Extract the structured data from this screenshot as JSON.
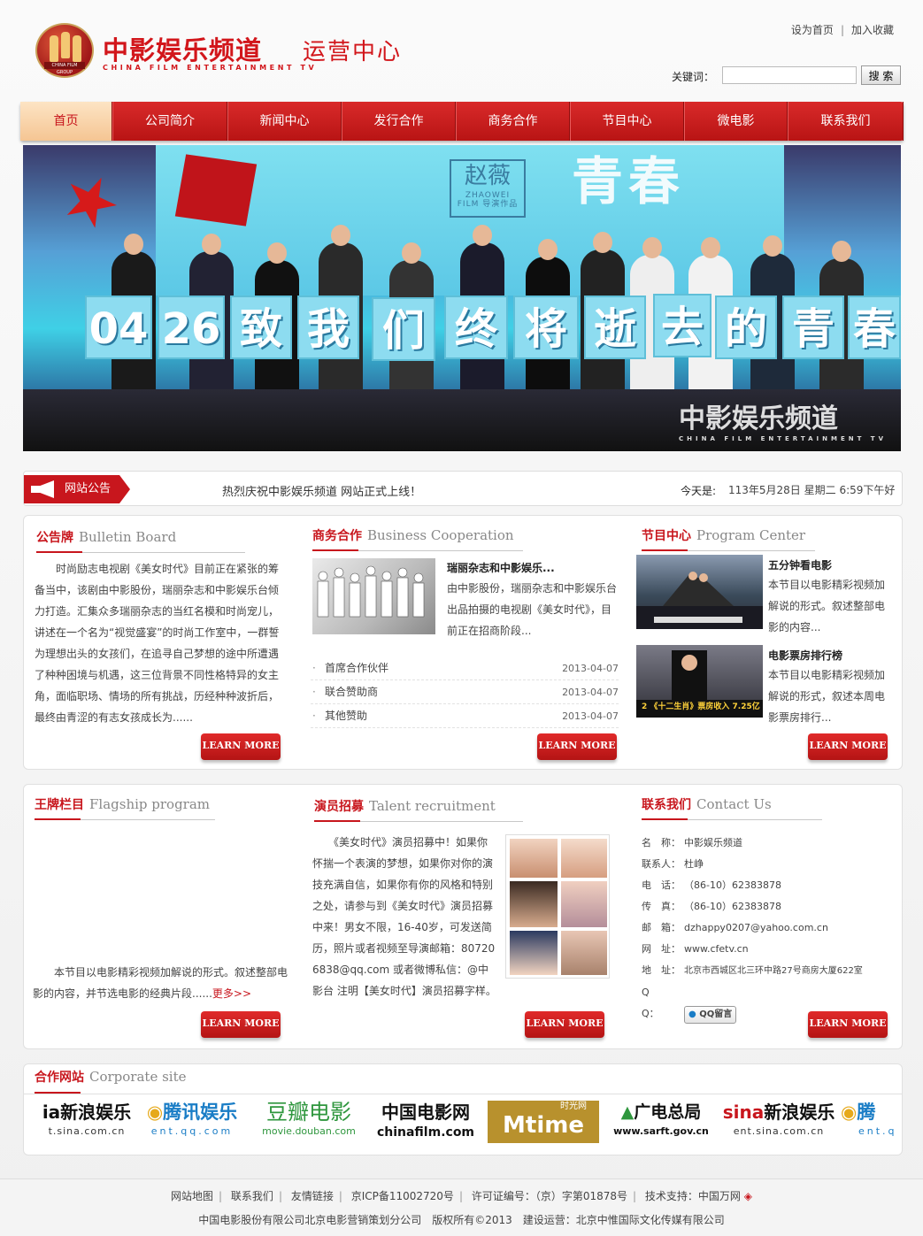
{
  "header": {
    "logo_cn": "中影娱乐频道",
    "logo_sub": "运营中心",
    "logo_en": "CHINA FILM ENTERTAINMENT TV",
    "logo_emblem_text": "CHINA FILM GROUP",
    "set_home": "设为首页",
    "add_fav": "加入收藏",
    "link_sep": "|",
    "search_label": "关键词：",
    "search_value": "",
    "search_button": "搜 索"
  },
  "nav": [
    "首页",
    "公司简介",
    "新闻中心",
    "发行合作",
    "商务合作",
    "节目中心",
    "微电影",
    "联系我们"
  ],
  "banner": {
    "card_text": [
      "04",
      "26",
      "致",
      "我",
      "们",
      "终",
      "将",
      "逝",
      "去",
      "的",
      "青",
      "春"
    ],
    "header_text": "青春",
    "director_cn": "赵薇",
    "director_en": "ZHAOWEI",
    "director_sub": "FILM 导演作品",
    "watermark_cn": "中影娱乐频道",
    "watermark_en": "CHINA FILM ENTERTAINMENT TV"
  },
  "notice": {
    "tag": "网站公告",
    "message": "热烈庆祝中影娱乐频道 网站正式上线！",
    "date_label": "今天是:",
    "date": "113年5月28日 星期二 6:59下午好"
  },
  "bulletin": {
    "title_cn": "公告牌",
    "title_en": "Bulletin Board",
    "text": "　　时尚励志电视剧《美女时代》目前正在紧张的筹备当中，该剧由中影股份，瑞丽杂志和中影娱乐台倾力打造。汇集众多瑞丽杂志的当红名模和时尚宠儿，讲述在一个名为“视觉盛宴”的时尚工作室中，一群誓为理想出头的女孩们，在追寻自己梦想的途中所遭遇了种种困境与机遇，这三位背景不同性格特异的女主角，面临职场、情场的所有挑战，历经种种波折后，最终由青涩的有志女孩成长为......",
    "more": "LEARN MORE"
  },
  "business": {
    "title_cn": "商务合作",
    "title_en": "Business Cooperation",
    "item_title": "瑞丽杂志和中影娱乐...",
    "item_desc": "由中影股份，瑞丽杂志和中影娱乐台出品拍摄的电视剧《美女时代》，目前正在招商阶段...",
    "list": [
      {
        "bullet": "·",
        "title": "首席合作伙伴",
        "date": "2013-04-07"
      },
      {
        "bullet": "·",
        "title": "联合赞助商",
        "date": "2013-04-07"
      },
      {
        "bullet": "·",
        "title": "其他赞助",
        "date": "2013-04-07"
      }
    ],
    "more": "LEARN MORE"
  },
  "program": {
    "title_cn": "节目中心",
    "title_en": "Program Center",
    "items": [
      {
        "title": "五分钟看电影",
        "desc": "本节目以电影精彩视频加解说的形式。叙述整部电影的内容..."
      },
      {
        "title": "电影票房排行榜",
        "desc": "本节目以电影精彩视频加解说的形式，叙述本周电影票房排行..."
      }
    ],
    "thumb2_caption": "2 《十二生肖》票房收入 7.25亿",
    "more": "LEARN MORE"
  },
  "flagship": {
    "title_cn": "王牌栏目",
    "title_en": "Flagship program",
    "text": "　　本节目以电影精彩视频加解说的形式。叙述整部电影的内容，并节选电影的经典片段......",
    "more_link": "更多>>",
    "more": "LEARN MORE"
  },
  "talent": {
    "title_cn": "演员招募",
    "title_en": "Talent recruitment",
    "text": "　　《美女时代》演员招募中！如果你怀揣一个表演的梦想，如果你对你的演技充满自信，如果你有你的风格和特别之处，请参与到《美女时代》演员招募中来！男女不限，16-40岁，可发送简历，照片或者视频至导演邮箱：807206838@qq.com 或者微博私信：@中影台 注明【美女时代】演员招募字样。",
    "more": "LEARN MORE"
  },
  "contact": {
    "title_cn": "联系我们",
    "title_en": "Contact Us",
    "rows": [
      {
        "label": "名　称：",
        "value": "中影娱乐频道"
      },
      {
        "label": "联系人：",
        "value": "杜峥"
      },
      {
        "label": "电　话：",
        "value": "（86-10）62383878"
      },
      {
        "label": "传　真：",
        "value": "（86-10）62383878"
      },
      {
        "label": "邮　箱：",
        "value": "dzhappy0207@yahoo.com.cn"
      },
      {
        "label": "网　址：",
        "value": "www.cfetv.cn"
      },
      {
        "label": "地　址：",
        "value": "北京市西城区北三环中路27号商房大厦622室"
      }
    ],
    "qq_label": "Q　　Q：",
    "qq_button": "QQ留言",
    "more": "LEARN MORE"
  },
  "partners": {
    "title_cn": "合作网站",
    "title_en": "Corporate site",
    "logos": [
      {
        "name": "新浪娱乐",
        "sub": "t.sina.com.cn",
        "prefix": "ia",
        "color": "#000"
      },
      {
        "name": "腾讯娱乐",
        "sub": "ent.qq.com",
        "prefix": "",
        "color": "#1a7dc6"
      },
      {
        "name": "豆瓣电影",
        "sub": "movie.douban.com",
        "prefix": "",
        "color": "#2e963d"
      },
      {
        "name": "中国电影网",
        "sub": "chinafilm.com",
        "prefix": "",
        "color": "#111"
      },
      {
        "name": "时光网",
        "sub": "Mtime",
        "prefix": "",
        "color": "#fff"
      },
      {
        "name": "广电总局",
        "sub": "www.sarft.gov.cn",
        "prefix": "",
        "color": "#111"
      },
      {
        "name": "新浪娱乐",
        "sub": "ent.sina.com.cn",
        "prefix": "sina",
        "color": "#111"
      },
      {
        "name": "腾",
        "sub": "ent.q",
        "prefix": "",
        "color": "#1a7dc6"
      }
    ]
  },
  "footer": {
    "links": [
      "网站地图",
      "联系我们",
      "友情链接",
      "京ICP备11002720号",
      "许可证编号：（京）字第01878号",
      "技术支持：中国万网"
    ],
    "copyright": "中国电影股份有限公司北京电影营销策划分公司　版权所有©2013　建设运营：北京中惟国际文化传媒有限公司"
  },
  "colors": {
    "brand": "#c8161d",
    "nav": "#c41b1b",
    "accent": "#f5c593"
  }
}
